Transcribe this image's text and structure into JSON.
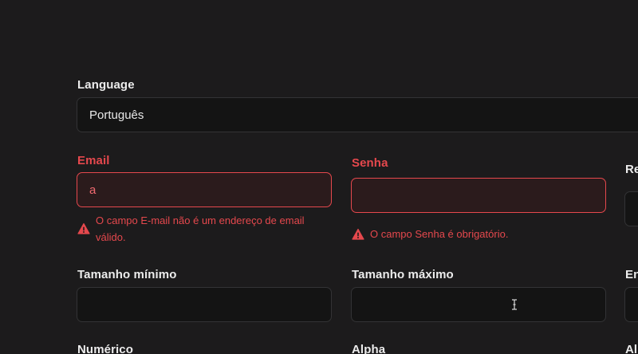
{
  "language": {
    "label": "Language",
    "value": "Português"
  },
  "email": {
    "label": "Email",
    "value": "a",
    "error": "O campo E-mail não é um endereço de email válido."
  },
  "senha": {
    "label": "Senha",
    "value": "",
    "error": "O campo Senha é obrigatório."
  },
  "third_col_row1": {
    "label": "Re"
  },
  "tamanho_minimo": {
    "label": "Tamanho mínimo",
    "value": ""
  },
  "tamanho_maximo": {
    "label": "Tamanho máximo",
    "value": ""
  },
  "third_col_row2": {
    "label": "En"
  },
  "numerico": {
    "label": "Numérico"
  },
  "alpha": {
    "label": "Alpha"
  },
  "third_col_row3": {
    "label": "Al"
  },
  "colors": {
    "error": "#e5484d",
    "background": "#1c1b1c",
    "field_bg": "#141414"
  },
  "icons": {
    "error": "warning-icon",
    "cursor": "text-cursor-icon"
  }
}
